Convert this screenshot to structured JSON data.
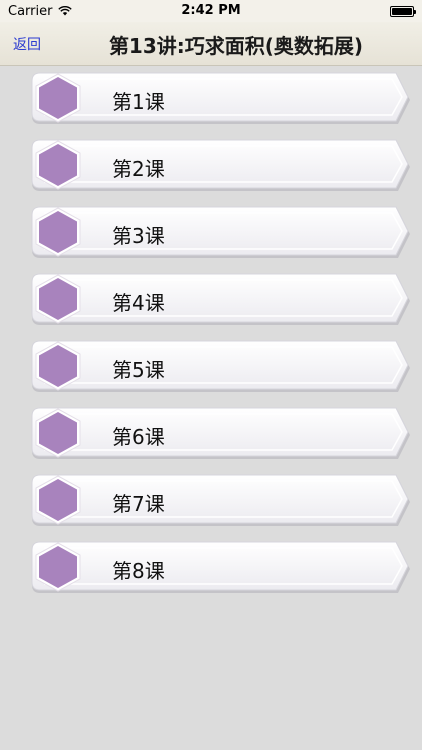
{
  "status_bar": {
    "carrier": "Carrier",
    "time": "2:42 PM"
  },
  "nav": {
    "back_label": "返回",
    "title": "第13讲:巧求面积(奥数拓展)"
  },
  "lessons": [
    {
      "label": "第1课"
    },
    {
      "label": "第2课"
    },
    {
      "label": "第3课"
    },
    {
      "label": "第4课"
    },
    {
      "label": "第5课"
    },
    {
      "label": "第6课"
    },
    {
      "label": "第7课"
    },
    {
      "label": "第8课"
    }
  ],
  "colors": {
    "hex_fill": "#a883bd",
    "back_link": "#2a3ad0",
    "background": "#dcdcdc"
  },
  "icons": {
    "lesson_icon": "hexagon-icon",
    "signal": "wifi-icon",
    "battery": "battery-icon"
  }
}
